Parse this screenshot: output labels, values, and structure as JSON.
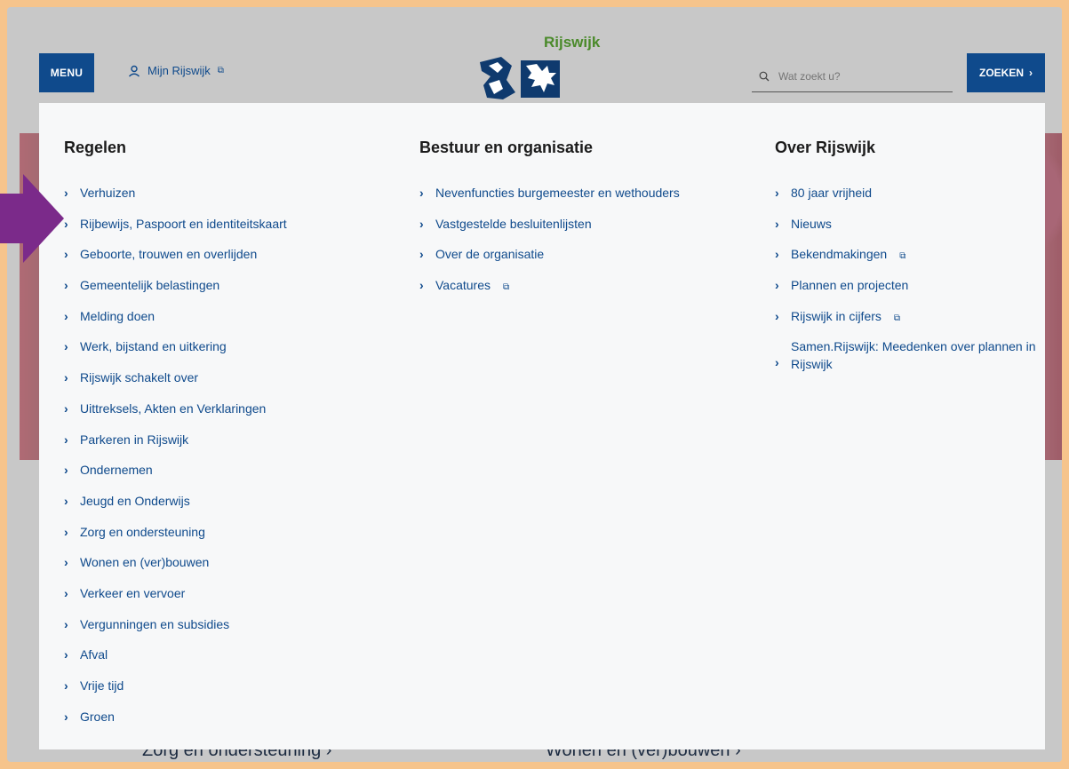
{
  "header": {
    "menu_label": "MENU",
    "mijn_label": "Mijn Rijswijk",
    "logo_text": "Rijswijk",
    "search_placeholder": "Wat zoekt u?",
    "search_button": "ZOEKEN"
  },
  "columns": [
    {
      "title": "Regelen",
      "items": [
        {
          "label": "Verhuizen"
        },
        {
          "label": "Rijbewijs, Paspoort en identiteitskaart"
        },
        {
          "label": "Geboorte, trouwen en overlijden"
        },
        {
          "label": "Gemeentelijk belastingen"
        },
        {
          "label": "Melding doen"
        },
        {
          "label": "Werk, bijstand en uitkering"
        },
        {
          "label": "Rijswijk schakelt over"
        },
        {
          "label": "Uittreksels, Akten en Verklaringen"
        },
        {
          "label": "Parkeren in Rijswijk"
        },
        {
          "label": "Ondernemen"
        },
        {
          "label": "Jeugd en Onderwijs"
        },
        {
          "label": "Zorg en ondersteuning"
        },
        {
          "label": "Wonen en (ver)bouwen"
        },
        {
          "label": "Verkeer en vervoer"
        },
        {
          "label": "Vergunningen en subsidies"
        },
        {
          "label": "Afval"
        },
        {
          "label": "Vrije tijd"
        },
        {
          "label": "Groen"
        }
      ]
    },
    {
      "title": "Bestuur en organisatie",
      "items": [
        {
          "label": "Nevenfuncties burgemeester en wethouders"
        },
        {
          "label": "Vastgestelde besluitenlijsten"
        },
        {
          "label": "Over de organisatie"
        },
        {
          "label": "Vacatures",
          "external": true
        }
      ]
    },
    {
      "title": "Over Rijswijk",
      "items": [
        {
          "label": "80 jaar vrijheid"
        },
        {
          "label": "Nieuws"
        },
        {
          "label": "Bekendmakingen",
          "external": true
        },
        {
          "label": "Plannen en projecten"
        },
        {
          "label": "Rijswijk in cijfers",
          "external": true
        },
        {
          "label": "Samen.Rijswijk: Meedenken over plannen in Rijswijk"
        }
      ]
    }
  ],
  "background_links": {
    "left": "Zorg en ondersteuning ›",
    "right": "Wonen en (ver)bouwen ›"
  },
  "icons": {
    "chevron": "›",
    "external": "⧉",
    "user": "user-icon",
    "search": "search-icon"
  },
  "colors": {
    "brand": "#0f4a8c",
    "logo_green": "#4a8a2a",
    "arrow": "#7b2a8a",
    "frame": "#f6c48c"
  }
}
